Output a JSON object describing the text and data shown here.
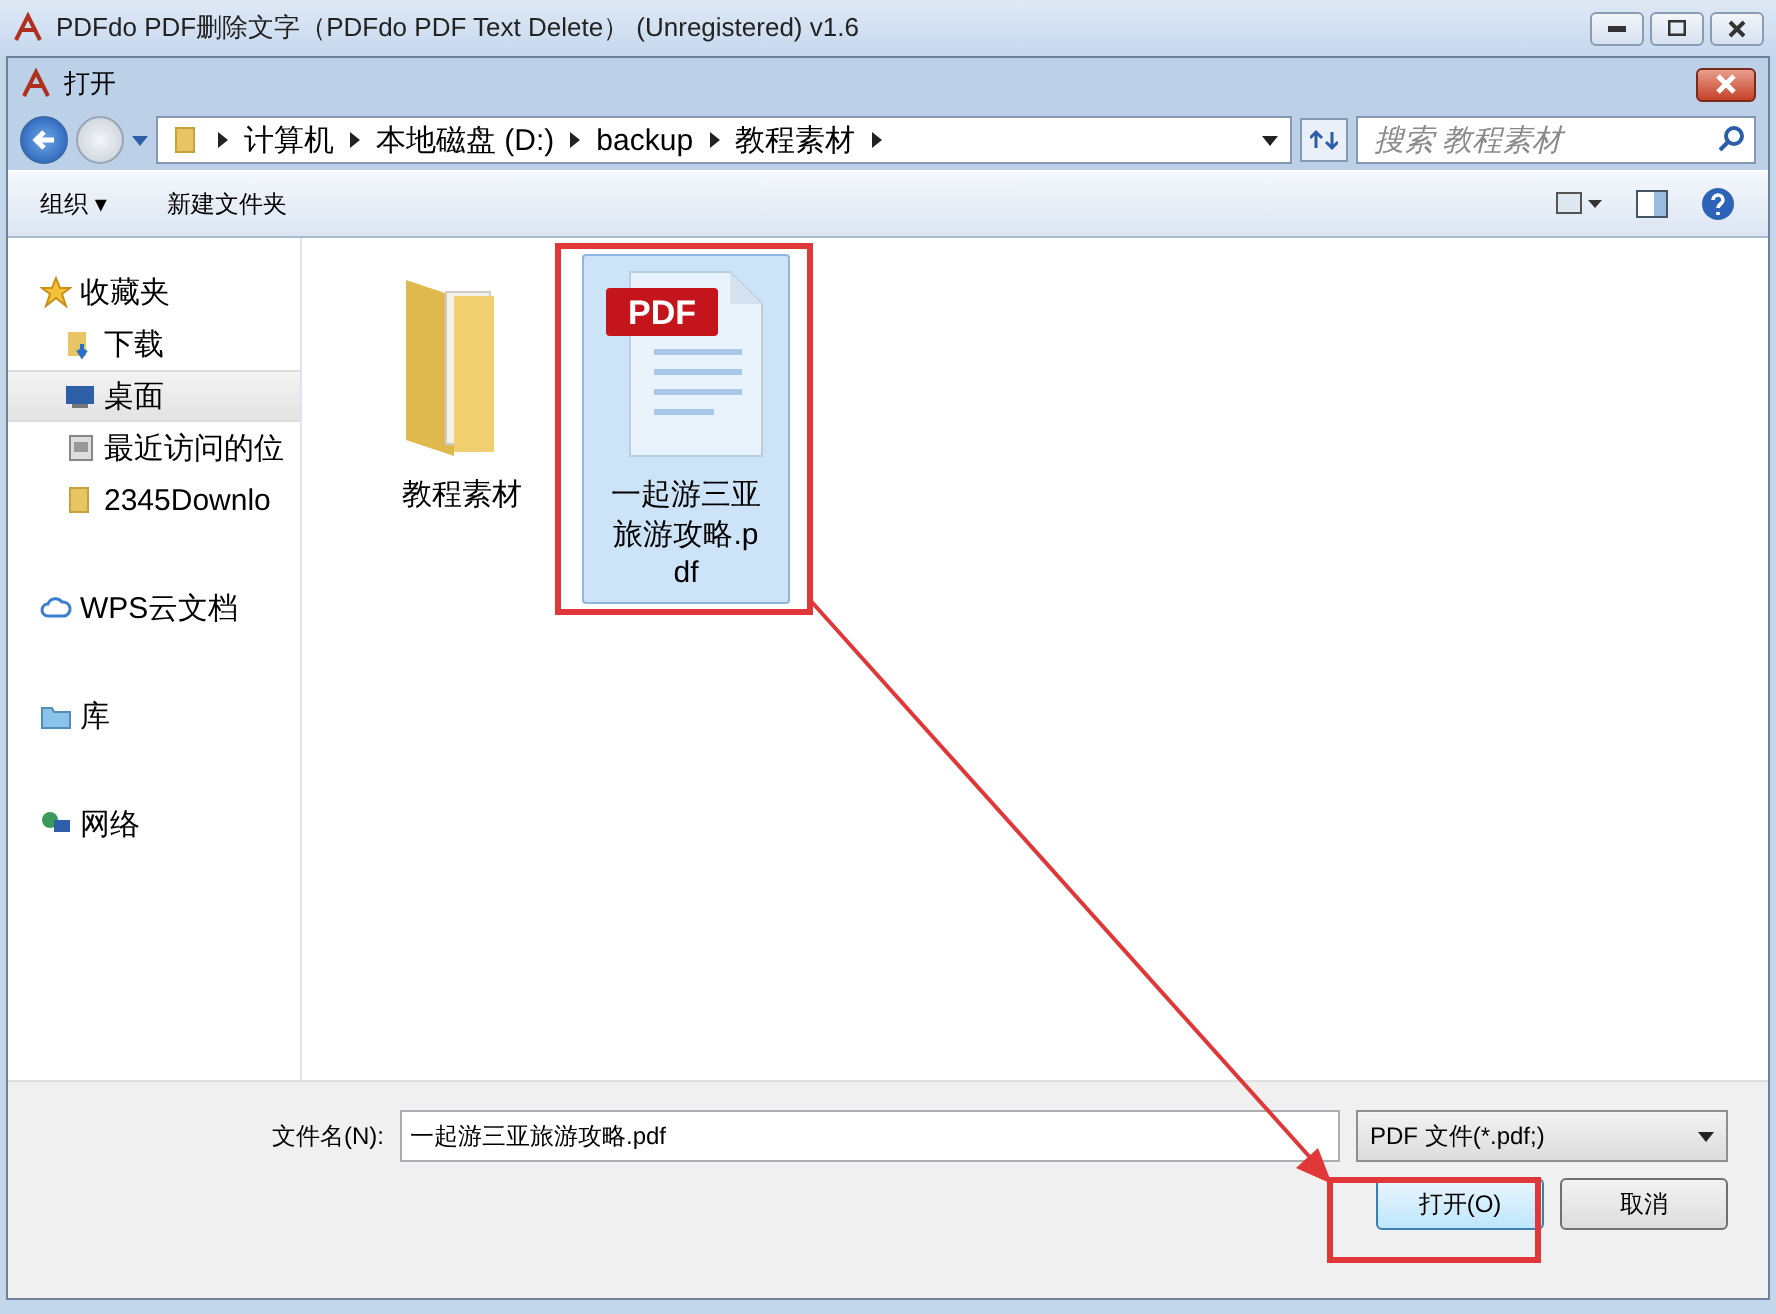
{
  "app_window": {
    "title": "PDFdo PDF删除文字（PDFdo PDF Text Delete） (Unregistered) v1.6"
  },
  "dialog": {
    "title": "打开"
  },
  "breadcrumb": [
    "计算机",
    "本地磁盘 (D:)",
    "backup",
    "教程素材"
  ],
  "search": {
    "placeholder": "搜索 教程素材"
  },
  "toolbar": {
    "organize": "组织 ▾",
    "new_folder": "新建文件夹"
  },
  "sidebar": [
    {
      "label": "收藏夹",
      "kind": "star",
      "selected": false,
      "children": [
        {
          "label": "下载",
          "kind": "download",
          "selected": false
        },
        {
          "label": "桌面",
          "kind": "desktop",
          "selected": true
        },
        {
          "label": "最近访问的位",
          "kind": "recent",
          "selected": false
        },
        {
          "label": "2345Downlo",
          "kind": "folder",
          "selected": false
        }
      ]
    },
    {
      "label": "WPS云文档",
      "kind": "cloud",
      "selected": false
    },
    {
      "label": "库",
      "kind": "library",
      "selected": false
    },
    {
      "label": "网络",
      "kind": "network",
      "selected": false
    }
  ],
  "files": [
    {
      "name": "教程素材",
      "kind": "folder",
      "selected": false
    },
    {
      "name": "一起游三亚旅游攻略.pdf",
      "kind": "pdf",
      "badge": "PDF",
      "selected": true
    }
  ],
  "filename": {
    "label": "文件名(N):",
    "value": "一起游三亚旅游攻略.pdf"
  },
  "filter": {
    "value": "PDF 文件(*.pdf;)"
  },
  "buttons": [
    "打开(O)",
    "取消"
  ]
}
